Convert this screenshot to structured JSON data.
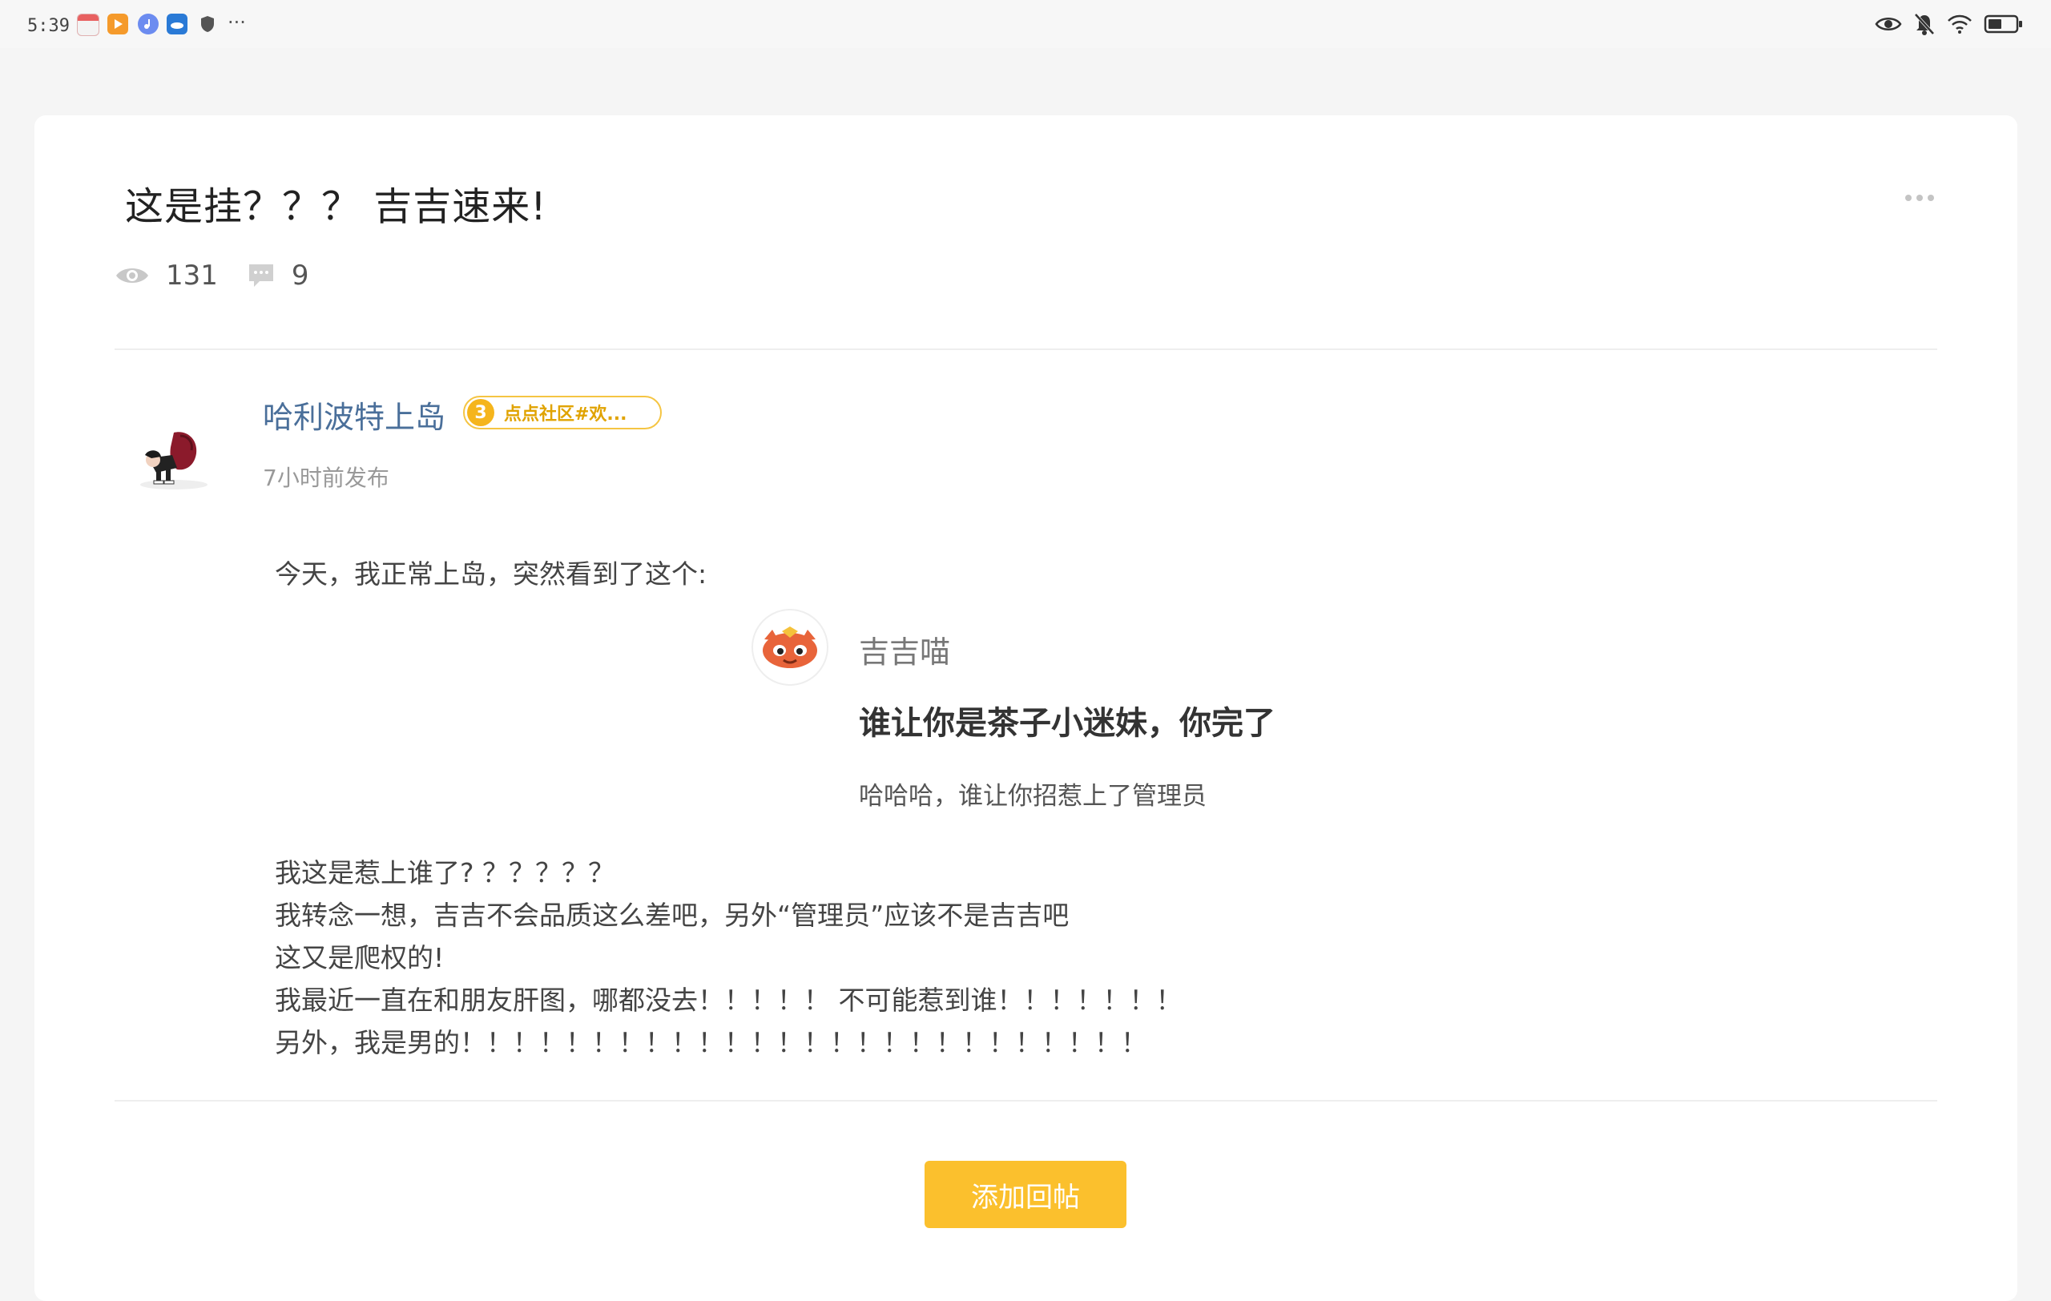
{
  "status_bar": {
    "time": "5:39",
    "more": "···"
  },
  "post": {
    "title": "这是挂？？？ 吉吉速来!",
    "views": "131",
    "comments": "9",
    "author": "哈利波特上岛",
    "badge_level": "3",
    "badge_text": "点点社区#欢...",
    "published": "7小时前发布",
    "intro": "今天，我正常上岛，突然看到了这个:",
    "embed": {
      "name": "吉吉喵",
      "title": "谁让你是茶子小迷妹，你完了",
      "subtitle": "哈哈哈，谁让你招惹上了管理员"
    },
    "lines": [
      "我这是惹上谁了? ？？？？？",
      "我转念一想，吉吉不会品质这么差吧，另外“管理员”应该不是吉吉吧",
      "这又是爬权的!",
      "我最近一直在和朋友肝图，哪都没去！！！！！ 不可能惹到谁！！！！！！！",
      "另外，我是男的！！！！！！！！！！！！！！！！！！！！！！！！！！"
    ]
  },
  "actions": {
    "reply_label": "添加回帖"
  },
  "colors": {
    "accent": "#fbc02d",
    "author": "#4a6f9a",
    "badge": "#f5b51c"
  }
}
